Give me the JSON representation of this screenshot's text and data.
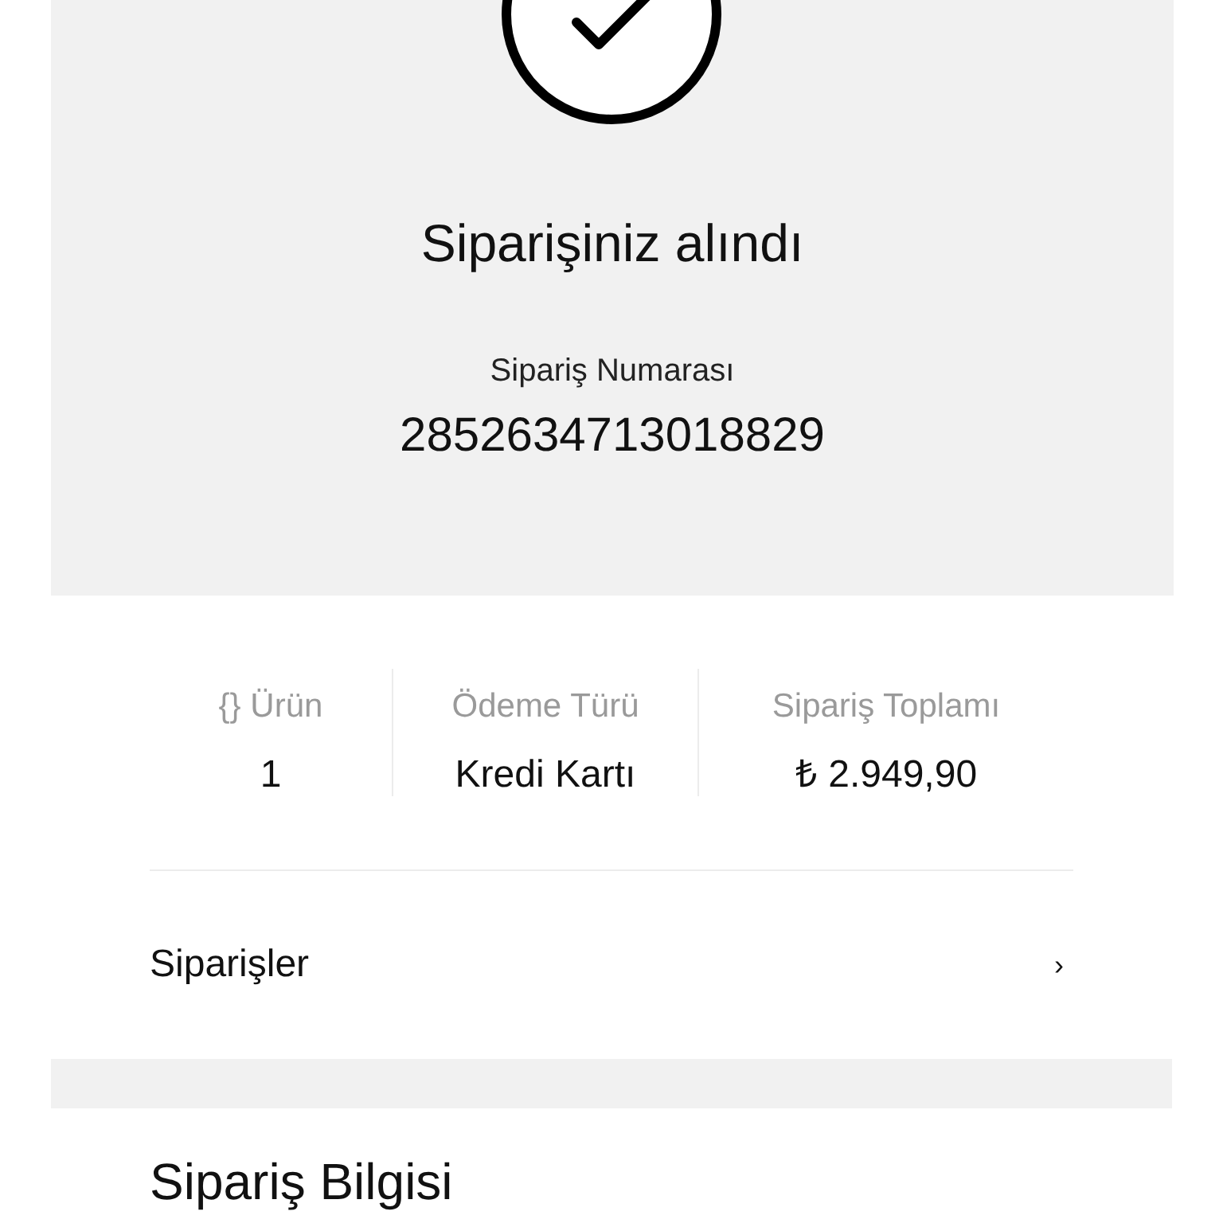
{
  "confirmation": {
    "title": "Siparişiniz alındı",
    "order_number_label": "Sipariş Numarası",
    "order_number": "2852634713018829"
  },
  "summary": [
    {
      "label": "{} Ürün",
      "value": "1"
    },
    {
      "label": "Ödeme Türü",
      "value": "Kredi Kartı"
    },
    {
      "label": "Sipariş Toplamı",
      "value": "₺ 2.949,90"
    }
  ],
  "orders_link": {
    "label": "Siparişler",
    "chevron": "›"
  },
  "section_title": "Sipariş Bilgisi"
}
